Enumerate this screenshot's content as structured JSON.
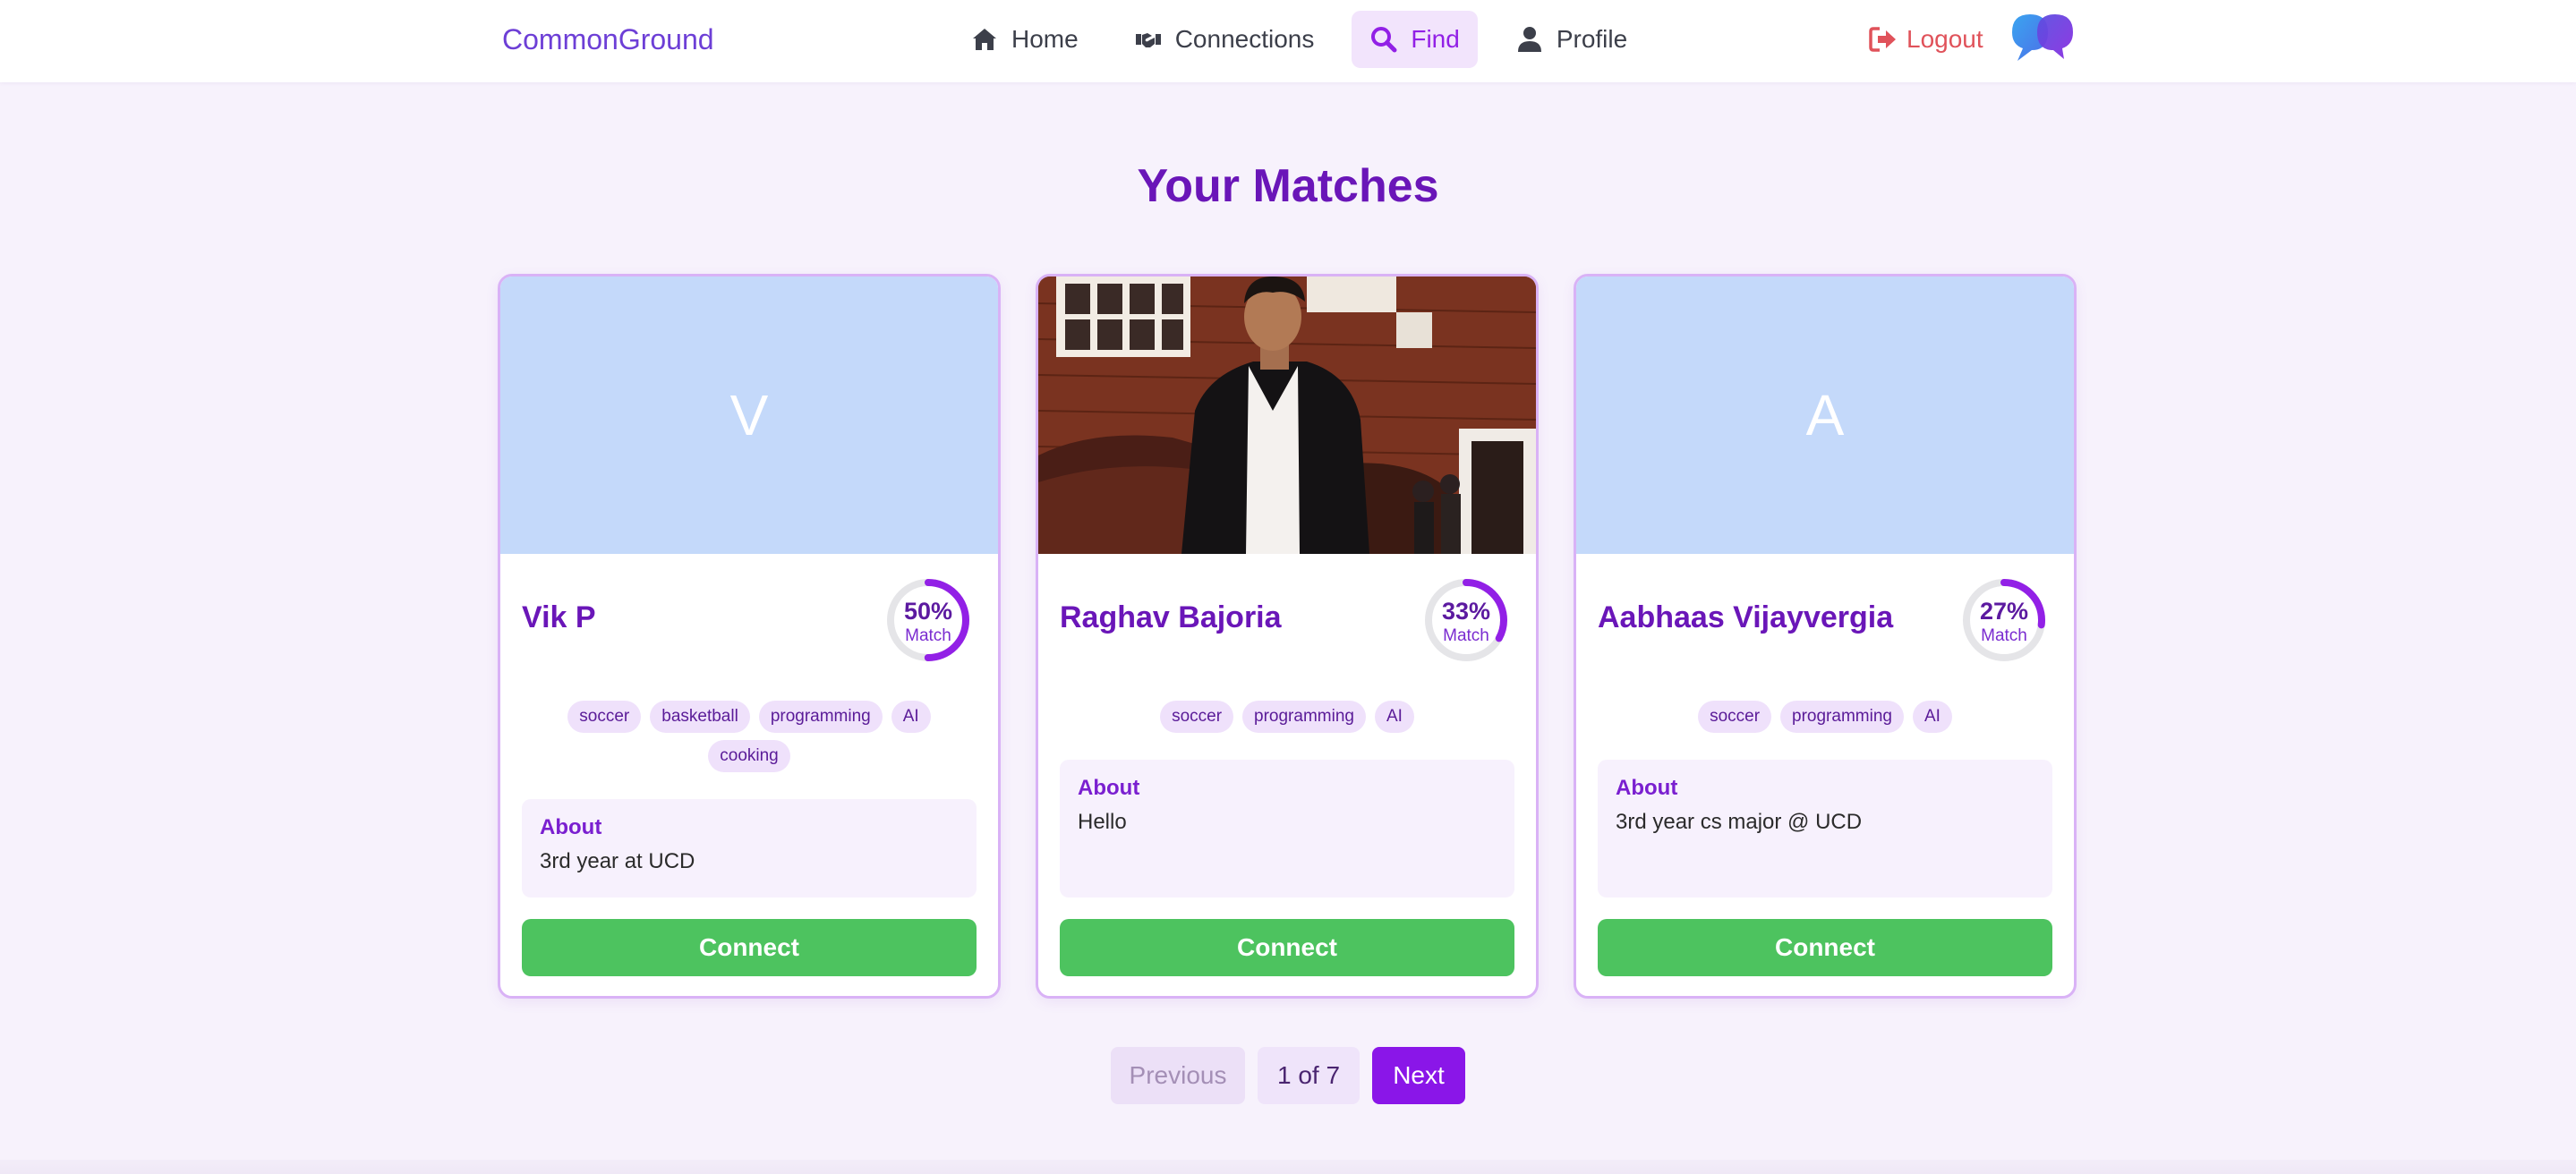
{
  "header": {
    "brand": "CommonGround",
    "nav": [
      {
        "label": "Home",
        "icon": "home-icon",
        "active": false
      },
      {
        "label": "Connections",
        "icon": "handshake-icon",
        "active": false
      },
      {
        "label": "Find",
        "icon": "search-icon",
        "active": true
      },
      {
        "label": "Profile",
        "icon": "user-icon",
        "active": false
      }
    ],
    "logout": "Logout",
    "logo_icon": "chat-bubbles-icon"
  },
  "page": {
    "title": "Your Matches"
  },
  "matches": [
    {
      "initial": "V",
      "name": "Vik P",
      "match_percent": 50,
      "match_text": "50%",
      "match_label": "Match",
      "interests": [
        "soccer",
        "basketball",
        "programming",
        "AI",
        "cooking"
      ],
      "about_heading": "About",
      "about": "3rd year at UCD",
      "connect": "Connect",
      "has_photo": false
    },
    {
      "initial": "",
      "name": "Raghav Bajoria",
      "match_percent": 33,
      "match_text": "33%",
      "match_label": "Match",
      "interests": [
        "soccer",
        "programming",
        "AI"
      ],
      "about_heading": "About",
      "about": "Hello",
      "connect": "Connect",
      "has_photo": true
    },
    {
      "initial": "A",
      "name": "Aabhaas Vijayvergia",
      "match_percent": 27,
      "match_text": "27%",
      "match_label": "Match",
      "interests": [
        "soccer",
        "programming",
        "AI"
      ],
      "about_heading": "About",
      "about": "3rd year cs major @ UCD",
      "connect": "Connect",
      "has_photo": false
    }
  ],
  "pagination": {
    "previous": "Previous",
    "info": "1 of 7",
    "next": "Next"
  },
  "colors": {
    "accent": "#8a16e8",
    "title": "#6a16b8",
    "connect": "#4dc35f",
    "logout": "#e0525a",
    "avatar_bg": "#c4d9fa"
  }
}
